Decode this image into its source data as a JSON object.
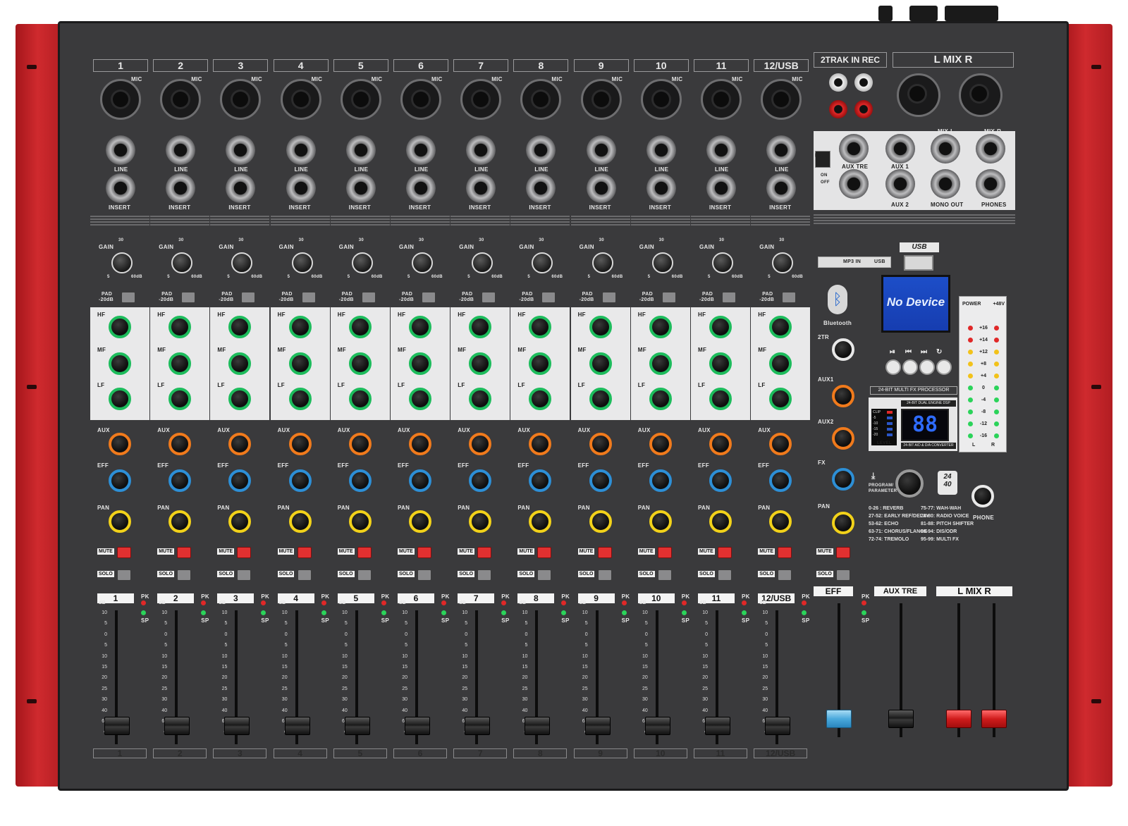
{
  "channels": [
    {
      "number": "1",
      "fader_label": "1",
      "fader_level": 0.08
    },
    {
      "number": "2",
      "fader_label": "2",
      "fader_level": 0.08
    },
    {
      "number": "3",
      "fader_label": "3",
      "fader_level": 0.08
    },
    {
      "number": "4",
      "fader_label": "4",
      "fader_level": 0.08
    },
    {
      "number": "5",
      "fader_label": "5",
      "fader_level": 0.08
    },
    {
      "number": "6",
      "fader_label": "6",
      "fader_level": 0.08
    },
    {
      "number": "7",
      "fader_label": "7",
      "fader_level": 0.08
    },
    {
      "number": "8",
      "fader_label": "8",
      "fader_level": 0.08
    },
    {
      "number": "9",
      "fader_label": "9",
      "fader_level": 0.08
    },
    {
      "number": "10",
      "fader_label": "10",
      "fader_level": 0.08
    },
    {
      "number": "11",
      "fader_label": "11",
      "fader_level": 0.08
    },
    {
      "number": "12/USB",
      "fader_label": "12/USB",
      "fader_level": 0.08
    }
  ],
  "labels": {
    "mic": "MIC",
    "line": "LINE",
    "insert": "INSERT",
    "gain": "GAIN",
    "gain_30": "30",
    "gain_5": "5",
    "gain_60": "60dB",
    "pad": "PAD",
    "pad_db": "-20dB",
    "hf": "HF",
    "mf": "MF",
    "lf": "LF",
    "aux": "AUX",
    "eff": "EFF",
    "pan": "PAN",
    "mute": "MUTE",
    "solo": "SOLO",
    "pk": "PK",
    "sp": "SP",
    "db": "dB"
  },
  "fader_scale": [
    "10",
    "5",
    "0",
    "5",
    "10",
    "15",
    "20",
    "25",
    "30",
    "40",
    "60",
    "∞"
  ],
  "right_section": {
    "two_track_title": "2TRAK IN  REC",
    "lmix_title": "L  MIX  R",
    "usb_switch": "USB",
    "usb_on": "ON",
    "usb_off": "OFF",
    "aux_tre": "AUX TRE",
    "aux1": "AUX 1",
    "aux2": "AUX 2",
    "mix_l": "MIX-L",
    "mix_r": "MIX-R",
    "mono_out": "MONO OUT",
    "phones": "PHONES",
    "mp3_in": "MP3 IN",
    "usb_logo": "USB",
    "usb_small": "USB",
    "bluetooth": "Bluetooth",
    "lcd_text": "No Device",
    "two_tr": "2TR",
    "aux1_knob": "AUX1",
    "aux2_knob": "AUX2",
    "fx_knob": "FX",
    "pan_knob": "PAN",
    "phone_knob": "PHONE",
    "fx_processor": "24-BIT MULTI FX PROCESSOR",
    "dsp": "24-BIT DUAL ENGINE DSP",
    "converter": "24-BIT A/D & D/A CONVERTER",
    "seg_display": "88",
    "program": "PROGRAM/",
    "parameter": "PARAMETER",
    "badge_24": "24",
    "badge_40": "40",
    "level": "LEVEL",
    "clip_scale": [
      "CLIP",
      "-5",
      "-10",
      "-15",
      "-20"
    ],
    "fx_presets_left": [
      "0-26 : REVERB",
      "27-52: EARLY REF/DELAY",
      "53-62: ECHO",
      "63-71: CHORUS/FLANGE",
      "72-74: TREMOLO"
    ],
    "fx_presets_right": [
      "75-77: WAH-WAH",
      "78-80: RADIO VOICE",
      "81-88: PITCH SHIFTER",
      "89-94: DIS/ODR",
      "95-99: MULTI FX"
    ],
    "meter_power": "POWER",
    "meter_48v": "+48V",
    "meter_scale": [
      "+16",
      "+14",
      "+12",
      "+8",
      "+4",
      "0",
      "-4",
      "-8",
      "-12",
      "-16"
    ],
    "meter_l": "L",
    "meter_r": "R",
    "eff_name": "EFF",
    "aux_tre_name": "AUX TRE",
    "lmix_name": "L  MIX  R",
    "eff_level": 0.08,
    "aux_tre_level": 0.08,
    "lmix_level": 0.08
  },
  "colors": {
    "chassis": "#3a3a3c",
    "side_panels": "#cf2a2e",
    "eq_knob": "#1dbc5c",
    "aux_knob": "#f07a1c",
    "eff_knob": "#2d8fd6",
    "pan_knob": "#f2d21a",
    "mute_button": "#e23030",
    "lcd": "#1d4ec8",
    "eff_fader_cap": "#4aa9dc",
    "main_fader_cap": "#d01c1c"
  }
}
